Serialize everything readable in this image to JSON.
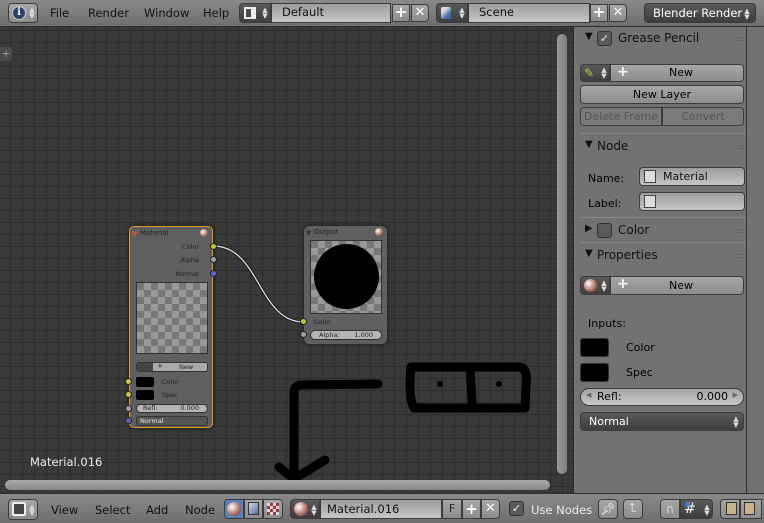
{
  "top_header": {
    "editor_type_icon": "info-icon",
    "menus": [
      "File",
      "Render",
      "Window",
      "Help"
    ],
    "screen_layout": {
      "icon": "layout-icon",
      "value": "Default"
    },
    "scene": {
      "icon": "scene-icon",
      "value": "Scene"
    },
    "render_engine": "Blender Render"
  },
  "node_editor": {
    "material_node": {
      "title": "Material",
      "outputs": [
        "Color",
        "Alpha",
        "Normal"
      ],
      "new_button": "New",
      "inputs": [
        "Color",
        "Spec"
      ],
      "refl_label": "Refl:",
      "refl_value": "0.000",
      "normal_select": "Normal"
    },
    "output_node": {
      "title": "Output",
      "input_color": "Color",
      "alpha_label": "Alpha:",
      "alpha_value": "1.000"
    },
    "material_name_overlay": "Material.016",
    "annotation": "hand-drawn grease pencil arrow pointing to a node-tree button pair"
  },
  "sidebar": {
    "grease_pencil": {
      "title": "Grease Pencil",
      "checked": true,
      "new_button": "New",
      "new_layer": "New Layer",
      "delete_frame": "Delete Frame",
      "convert": "Convert"
    },
    "node": {
      "title": "Node",
      "name_label": "Name:",
      "name_value": "Material",
      "label_label": "Label:",
      "label_value": ""
    },
    "color": {
      "title": "Color",
      "checked": false
    },
    "properties": {
      "title": "Properties",
      "new_button": "New",
      "inputs_label": "Inputs:",
      "inputs": [
        "Color",
        "Spec"
      ],
      "refl_label": "Refl:",
      "refl_value": "0.000",
      "normal_select": "Normal"
    }
  },
  "bottom_header": {
    "menus": [
      "View",
      "Select",
      "Add",
      "Node"
    ],
    "shader_types": [
      "material-shader-icon",
      "texture-icon",
      "compositing-icon"
    ],
    "material_name": "Material.016",
    "fake_user": "F",
    "use_nodes_label": "Use Nodes",
    "use_nodes_checked": true
  },
  "colors": {
    "socket_color": "#c7c729",
    "socket_gray": "#a1a1a1",
    "socket_vector": "#6363c7",
    "node_active_border": "#e8961e",
    "editor_bg": "#393939",
    "panel_bg": "#727272"
  }
}
